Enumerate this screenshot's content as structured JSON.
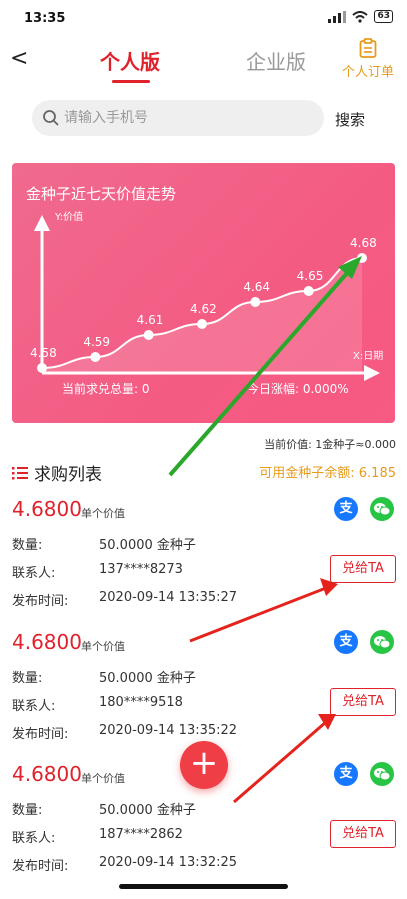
{
  "status_bar": {
    "time": "13:35",
    "battery": "63"
  },
  "nav": {
    "back": "<",
    "tab_personal": "个人版",
    "tab_enterprise": "企业版",
    "orders_label": "个人订单"
  },
  "search": {
    "placeholder": "请输入手机号",
    "button": "搜索"
  },
  "chart_data": {
    "type": "line",
    "title": "金种子近七天价值走势",
    "ylabel": "Y:价值",
    "xlabel": "X:日期",
    "values": [
      4.58,
      4.59,
      4.61,
      4.62,
      4.64,
      4.65,
      4.68
    ],
    "value_labels": [
      "4.58",
      "4.59",
      "4.61",
      "4.62",
      "4.64",
      "4.65",
      "4.68"
    ],
    "colors": {
      "background": "#f45b83",
      "line": "#ffffff"
    }
  },
  "card_footer": {
    "total": "当前求兑总量: 0",
    "change": "今日涨幅: 0.000%"
  },
  "current_price": "当前价值: 1金种子≈0.000",
  "list": {
    "title": "求购列表",
    "balance": "可用金种子余额: 6.185",
    "labels": {
      "unit": "单个价值",
      "qty": "数量:",
      "contact": "联系人:",
      "time": "发布时间:",
      "give": "兑给TA"
    },
    "items": [
      {
        "price": "4.6800",
        "qty": "50.0000 金种子",
        "contact": "137****8273",
        "time": "2020-09-14 13:35:27"
      },
      {
        "price": "4.6800",
        "qty": "50.0000 金种子",
        "contact": "180****9518",
        "time": "2020-09-14 13:35:22"
      },
      {
        "price": "4.6800",
        "qty": "50.0000 金种子",
        "contact": "187****2862",
        "time": "2020-09-14 13:32:25"
      }
    ]
  },
  "fab": "+",
  "annotation_colors": {
    "green_arrow": "#2ba82b",
    "red_arrow": "#e5231c"
  },
  "icons": {
    "alipay": "支",
    "wechat": "wechat-icon"
  }
}
